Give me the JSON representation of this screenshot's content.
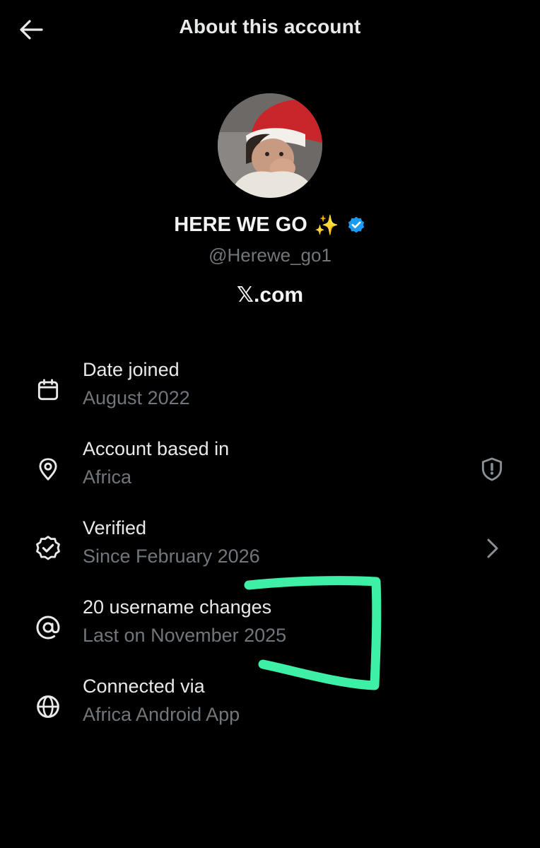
{
  "header": {
    "title": "About this account",
    "back_icon": "arrow-left-icon"
  },
  "profile": {
    "display_name": "HERE WE GO",
    "emoji": "✨",
    "verified_badge": "verified-badge-icon",
    "verified_color": "#1d9bf0",
    "handle": "@Herewe_go1",
    "site": "𝕏.com"
  },
  "rows": [
    {
      "icon": "calendar-icon",
      "label": "Date joined",
      "value": "August 2022"
    },
    {
      "icon": "location-pin-icon",
      "label": "Account based in",
      "value": "Africa",
      "trailing_icon": "shield-exclamation-icon"
    },
    {
      "icon": "verified-check-icon",
      "label": "Verified",
      "value": "Since February 2026",
      "trailing_icon": "chevron-right-icon"
    },
    {
      "icon": "at-sign-icon",
      "label": "20 username changes",
      "value": "Last on November 2025"
    },
    {
      "icon": "globe-icon",
      "label": "Connected via",
      "value": "Africa Android App"
    }
  ],
  "colors": {
    "background": "#000000",
    "primary_text": "#e7e9ea",
    "secondary_text": "#71767b",
    "annotation_marker": "#3ef0a6"
  }
}
